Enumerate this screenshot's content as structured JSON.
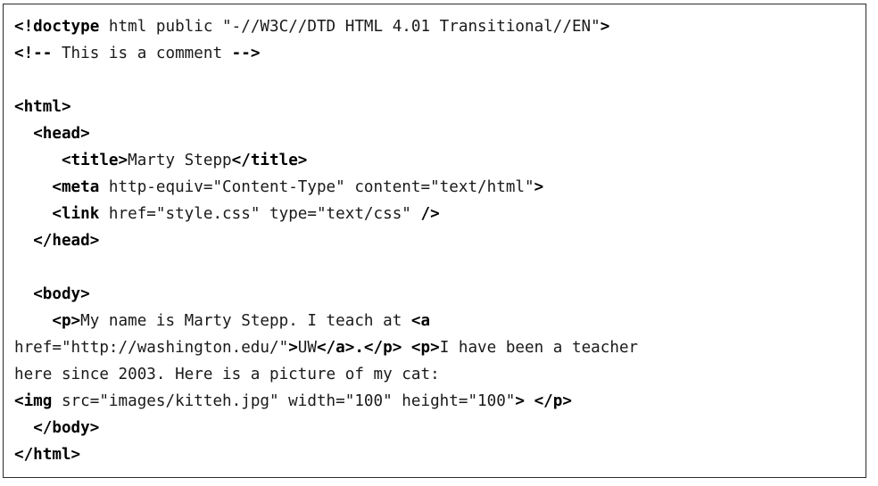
{
  "document": {
    "kind": "code-listing",
    "language": "html",
    "border_color": "#2b2b2b",
    "background_color": "#ffffff",
    "text_color": "#111111",
    "lines": [
      {
        "id": "line-doctype",
        "segments": [
          {
            "weight": "bold",
            "text": "<!doctype"
          },
          {
            "weight": "normal",
            "text": " html public \"-//W3C//DTD HTML 4.01 Transitional//EN\""
          },
          {
            "weight": "bold",
            "text": ">"
          }
        ]
      },
      {
        "id": "line-comment",
        "segments": [
          {
            "weight": "bold",
            "text": "<!--"
          },
          {
            "weight": "normal",
            "text": " This is a comment "
          },
          {
            "weight": "bold",
            "text": "-->"
          }
        ]
      },
      {
        "id": "line-blank-1",
        "segments": [
          {
            "weight": "normal",
            "text": ""
          }
        ]
      },
      {
        "id": "line-html-open",
        "segments": [
          {
            "weight": "bold",
            "text": "<html>"
          }
        ]
      },
      {
        "id": "line-head-open",
        "segments": [
          {
            "weight": "normal",
            "text": "  "
          },
          {
            "weight": "bold",
            "text": "<head>"
          }
        ]
      },
      {
        "id": "line-title",
        "segments": [
          {
            "weight": "normal",
            "text": "     "
          },
          {
            "weight": "bold",
            "text": "<title>"
          },
          {
            "weight": "normal",
            "text": "Marty Stepp"
          },
          {
            "weight": "bold",
            "text": "</title>"
          }
        ]
      },
      {
        "id": "line-meta",
        "segments": [
          {
            "weight": "normal",
            "text": "    "
          },
          {
            "weight": "bold",
            "text": "<meta"
          },
          {
            "weight": "normal",
            "text": " http-equiv=\"Content-Type\" content=\"text/html\""
          },
          {
            "weight": "bold",
            "text": ">"
          }
        ]
      },
      {
        "id": "line-link",
        "segments": [
          {
            "weight": "normal",
            "text": "    "
          },
          {
            "weight": "bold",
            "text": "<link"
          },
          {
            "weight": "normal",
            "text": " href=\"style.css\" type=\"text/css\" "
          },
          {
            "weight": "bold",
            "text": "/>"
          }
        ]
      },
      {
        "id": "line-head-close",
        "segments": [
          {
            "weight": "normal",
            "text": "  "
          },
          {
            "weight": "bold",
            "text": "</head>"
          }
        ]
      },
      {
        "id": "line-blank-2",
        "segments": [
          {
            "weight": "normal",
            "text": ""
          }
        ]
      },
      {
        "id": "line-body-open",
        "segments": [
          {
            "weight": "normal",
            "text": "  "
          },
          {
            "weight": "bold",
            "text": "<body>"
          }
        ]
      },
      {
        "id": "line-paragraph-1",
        "segments": [
          {
            "weight": "normal",
            "text": "    "
          },
          {
            "weight": "bold",
            "text": "<p>"
          },
          {
            "weight": "normal",
            "text": "My name is Marty Stepp. I teach at "
          },
          {
            "weight": "bold",
            "text": "<a"
          }
        ]
      },
      {
        "id": "line-anchor-wrap",
        "segments": [
          {
            "weight": "normal",
            "text": "href=\"http://washington.edu/\""
          },
          {
            "weight": "bold",
            "text": ">"
          },
          {
            "weight": "normal",
            "text": "UW"
          },
          {
            "weight": "bold",
            "text": "</a>.</p>"
          },
          {
            "weight": "normal",
            "text": " "
          },
          {
            "weight": "bold",
            "text": "<p>"
          },
          {
            "weight": "normal",
            "text": "I have been a teacher"
          }
        ]
      },
      {
        "id": "line-paragraph-2-wrap",
        "segments": [
          {
            "weight": "normal",
            "text": "here since 2003. Here is a picture of my cat:"
          }
        ]
      },
      {
        "id": "line-img",
        "segments": [
          {
            "weight": "bold",
            "text": "<img"
          },
          {
            "weight": "normal",
            "text": " src=\"images/kitteh.jpg\" width=\"100\" height=\"100\""
          },
          {
            "weight": "bold",
            "text": ">"
          },
          {
            "weight": "normal",
            "text": " "
          },
          {
            "weight": "bold",
            "text": "</p>"
          }
        ]
      },
      {
        "id": "line-body-close",
        "segments": [
          {
            "weight": "normal",
            "text": "  "
          },
          {
            "weight": "bold",
            "text": "</body>"
          }
        ]
      },
      {
        "id": "line-html-close",
        "segments": [
          {
            "weight": "bold",
            "text": "</html>"
          }
        ]
      }
    ]
  }
}
